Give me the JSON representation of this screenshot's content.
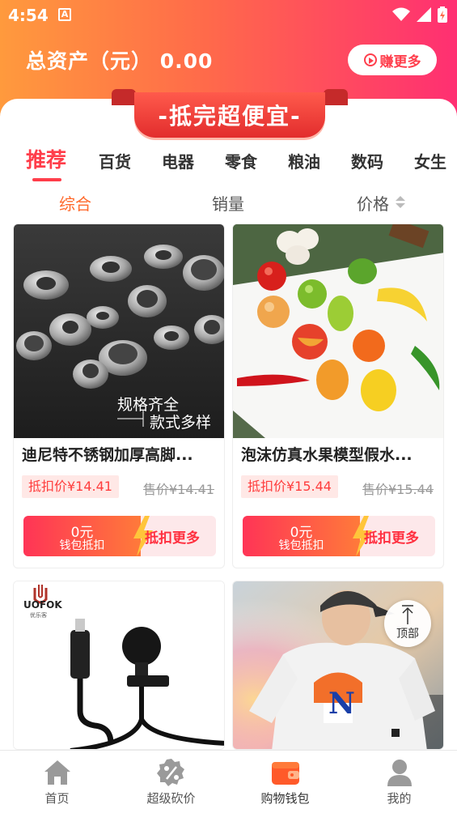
{
  "status_bar": {
    "time": "4:54",
    "notif_letter": "A"
  },
  "header": {
    "assets_label": "总资产（元） 0.00",
    "earn_more": "赚更多"
  },
  "banner": {
    "text": "-抵完超便宜-"
  },
  "categories": [
    "推荐",
    "百货",
    "电器",
    "零食",
    "粮油",
    "数码",
    "女生"
  ],
  "active_category": "推荐",
  "sort": {
    "items": [
      "综合",
      "销量",
      "价格"
    ],
    "active": "综合"
  },
  "products": [
    {
      "title": "迪尼特不锈钢加厚高脚...",
      "deduct_price": "抵扣价¥14.41",
      "original_price": "售价¥14.41",
      "image_caption_1": "规格齐全",
      "image_caption_2": "款式多样",
      "wallet_amount": "0元",
      "wallet_label": "钱包抵扣",
      "more_label": "抵扣更多"
    },
    {
      "title": "泡沫仿真水果模型假水...",
      "deduct_price": "抵扣价¥15.44",
      "original_price": "售价¥15.44",
      "wallet_amount": "0元",
      "wallet_label": "钱包抵扣",
      "more_label": "抵扣更多"
    },
    {
      "brand": "UOFOK",
      "brand_sub": "优乐客"
    },
    {
      "shirt_letter": "N"
    }
  ],
  "back_to_top": "顶部",
  "nav": [
    {
      "label": "首页",
      "icon": "home-icon"
    },
    {
      "label": "超级砍价",
      "icon": "discount-icon"
    },
    {
      "label": "购物钱包",
      "icon": "wallet-icon"
    },
    {
      "label": "我的",
      "icon": "profile-icon"
    }
  ],
  "colors": {
    "accent": "#ff3d4a",
    "orange": "#ff6a2c"
  }
}
